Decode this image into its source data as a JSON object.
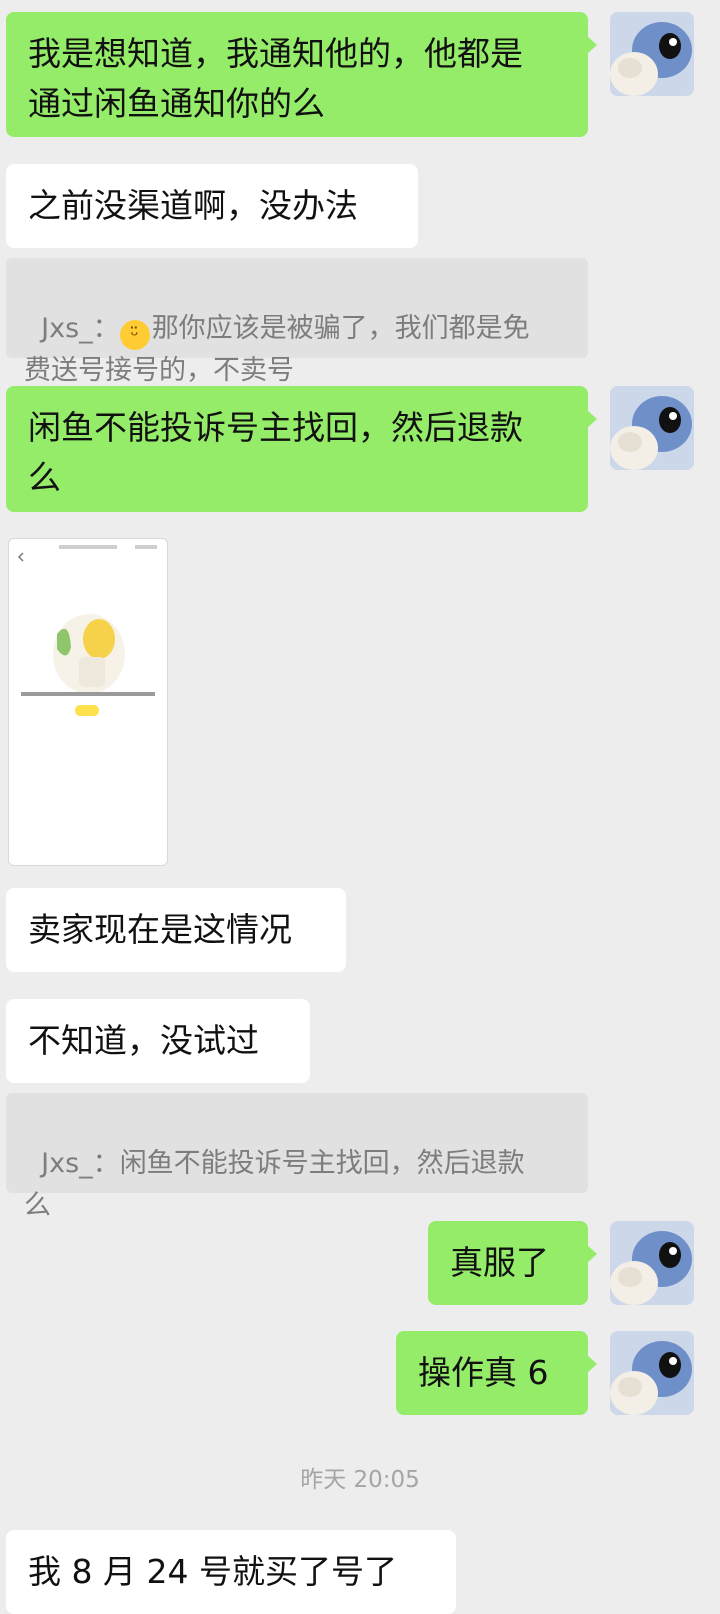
{
  "messages": [
    {
      "id": "m1",
      "text": "我是想知道，我通知他的，他都是\n通过闲鱼通知你的么"
    },
    {
      "id": "m2",
      "text": "之前没渠道啊，没办法"
    },
    {
      "id": "q1",
      "sender": "Jxs_：",
      "text": "那你应该是被骗了，我们都是免\n费送号接号的，不卖号"
    },
    {
      "id": "m3",
      "text": "闲鱼不能投诉号主找回，然后退款\n么"
    },
    {
      "id": "m4",
      "text": "卖家现在是这情况"
    },
    {
      "id": "m5",
      "text": "不知道，没试过"
    },
    {
      "id": "q2",
      "sender": "Jxs_：",
      "text": "闲鱼不能投诉号主找回，然后退款\n么"
    },
    {
      "id": "m6",
      "text": "真服了"
    },
    {
      "id": "m7",
      "text": "操作真 6"
    },
    {
      "id": "m8",
      "text": "我 8 月 24 号就买了号了"
    }
  ],
  "timestamp": "昨天 20:05",
  "colors": {
    "outgoing": "#95ec69",
    "incoming": "#ffffff",
    "background": "#ededed"
  },
  "icons": {
    "emoji": "sweat-smile-emoji-icon",
    "avatar": "stitch-plush-avatar"
  }
}
